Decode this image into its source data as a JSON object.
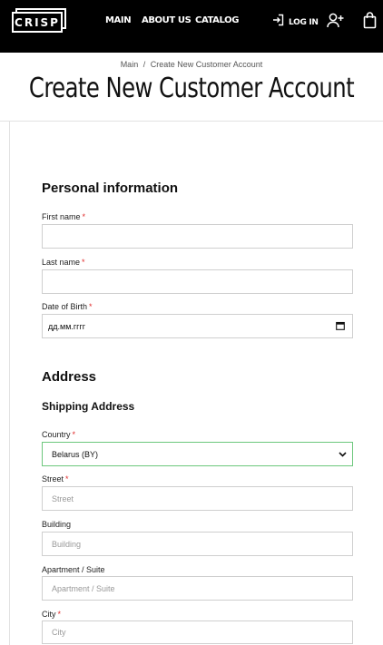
{
  "header": {
    "logo_text": "CRISP",
    "nav": [
      "MAIN",
      "ABOUT US",
      "CATALOG"
    ],
    "login_label": "LOG IN",
    "icons": [
      "login-icon",
      "add-user-icon",
      "shopping-bag-icon"
    ]
  },
  "breadcrumb": {
    "home": "Main",
    "separator": "/",
    "current": "Create New Customer Account"
  },
  "page_title": "Create New Customer Account",
  "personal": {
    "title": "Personal information",
    "first_name": {
      "label": "First name",
      "required": "*",
      "value": ""
    },
    "last_name": {
      "label": "Last name",
      "required": "*",
      "value": ""
    },
    "dob": {
      "label": "Date of Birth",
      "required": "*",
      "value": "дд.мм.гггг"
    }
  },
  "address": {
    "title": "Address",
    "shipping_title": "Shipping Address",
    "country": {
      "label": "Country",
      "required": "*",
      "value": "Belarus (BY)"
    },
    "street": {
      "label": "Street",
      "required": "*",
      "placeholder": "Street"
    },
    "building": {
      "label": "Building",
      "placeholder": "Building"
    },
    "apartment": {
      "label": "Apartment / Suite",
      "placeholder": "Apartment / Suite"
    },
    "city": {
      "label": "City",
      "required": "*",
      "placeholder": "City"
    }
  },
  "colors": {
    "header_bg": "#000000",
    "required": "#e02b2b",
    "select_focus_border": "#6cc77c"
  }
}
